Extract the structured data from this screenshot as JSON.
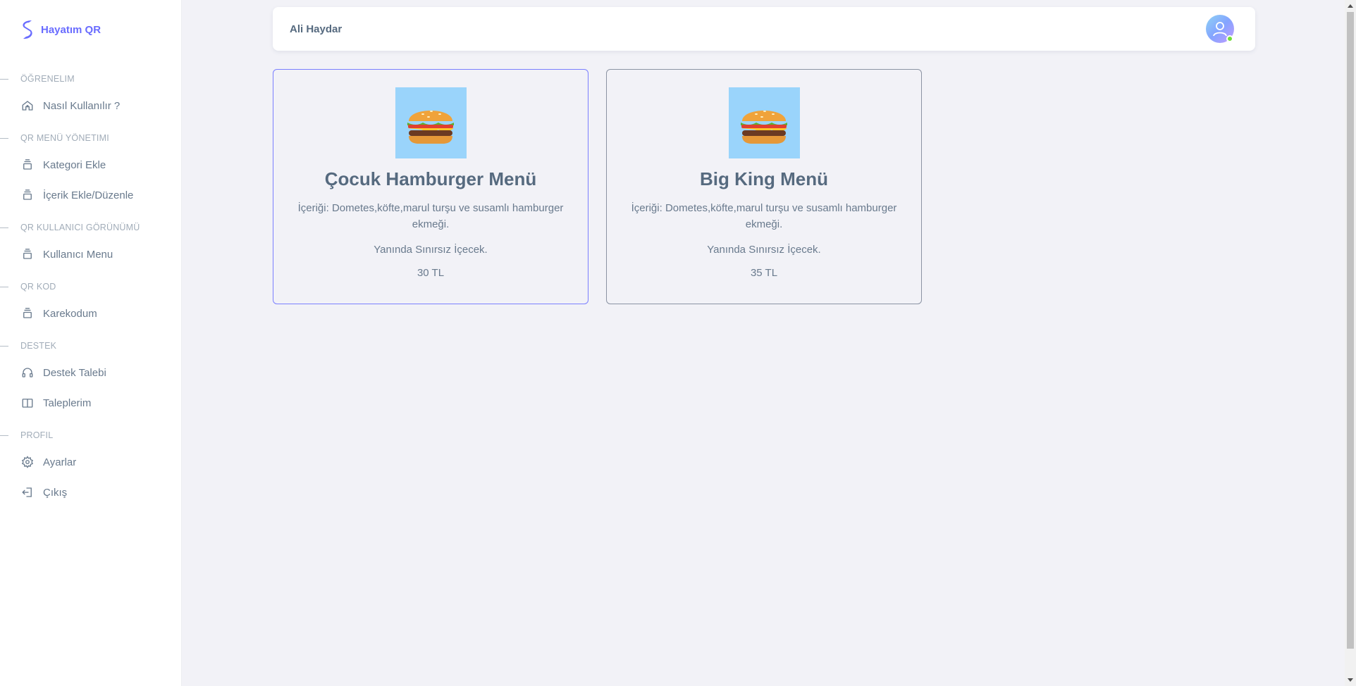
{
  "brand": {
    "name": "Hayatım QR",
    "accent": "#696cff"
  },
  "sidebar": {
    "sections": [
      {
        "header": "ÖĞRENELIM",
        "items": [
          {
            "label": "Nasıl Kullanılır ?",
            "icon": "home-icon"
          }
        ]
      },
      {
        "header": "QR MENÜ YÖNETIMI",
        "items": [
          {
            "label": "Kategori Ekle",
            "icon": "layers-icon"
          },
          {
            "label": "İçerik Ekle/Düzenle",
            "icon": "layers-icon"
          }
        ]
      },
      {
        "header": "QR KULLANICI GÖRÜNÜMÜ",
        "items": [
          {
            "label": "Kullanıcı Menu",
            "icon": "layers-icon"
          }
        ]
      },
      {
        "header": "QR KOD",
        "items": [
          {
            "label": "Karekodum",
            "icon": "layers-icon"
          }
        ]
      },
      {
        "header": "DESTEK",
        "items": [
          {
            "label": "Destek Talebi",
            "icon": "headphones-icon"
          },
          {
            "label": "Taleplerim",
            "icon": "book-icon"
          }
        ]
      },
      {
        "header": "PROFIL",
        "items": [
          {
            "label": "Ayarlar",
            "icon": "gear-icon"
          },
          {
            "label": "Çıkış",
            "icon": "logout-icon"
          }
        ]
      }
    ]
  },
  "navbar": {
    "user_name": "Ali Haydar",
    "avatar_icon": "user-avatar-icon",
    "status_color": "#71dd37"
  },
  "cards": [
    {
      "title": "Çocuk Hamburger Menü",
      "description": "İçeriği: Dometes,köfte,marul turşu ve susamlı hamburger ekmeği.",
      "extra": "Yanında Sınırsız İçecek.",
      "price": "30 TL",
      "image_icon": "hamburger-icon"
    },
    {
      "title": "Big King Menü",
      "description": "İçeriği: Dometes,köfte,marul turşu ve susamlı hamburger ekmeği.",
      "extra": "Yanında Sınırsız İçecek.",
      "price": "35 TL",
      "image_icon": "hamburger-icon"
    }
  ]
}
